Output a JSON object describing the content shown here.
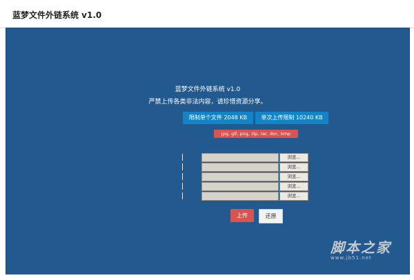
{
  "header": {
    "app_title": "蓝梦文件外链系统 v1.0"
  },
  "main": {
    "sub_title": "蓝梦文件外链系统 v1.0",
    "notice": "严禁上传各类非法内容，请珍惜资源分享。",
    "limit_file": "限制单个文件 2048 KB",
    "limit_total": "单次上传限制 10240 KB",
    "allowed_types": "jpg, gif, png, zip, rar, doc, bmp",
    "file_inputs": [
      {
        "value": "",
        "browse_label": "浏览..."
      },
      {
        "value": "",
        "browse_label": "浏览..."
      },
      {
        "value": "",
        "browse_label": "浏览..."
      },
      {
        "value": "",
        "browse_label": "浏览..."
      },
      {
        "value": "",
        "browse_label": "浏览..."
      }
    ],
    "upload_label": "上传",
    "reset_label": "还原"
  },
  "watermark": {
    "main": "脚本之家",
    "url": "www.jb51.net"
  },
  "colors": {
    "panel_bg": "#225a8f",
    "accent_blue": "#1185c7",
    "accent_red": "#d9534f"
  }
}
